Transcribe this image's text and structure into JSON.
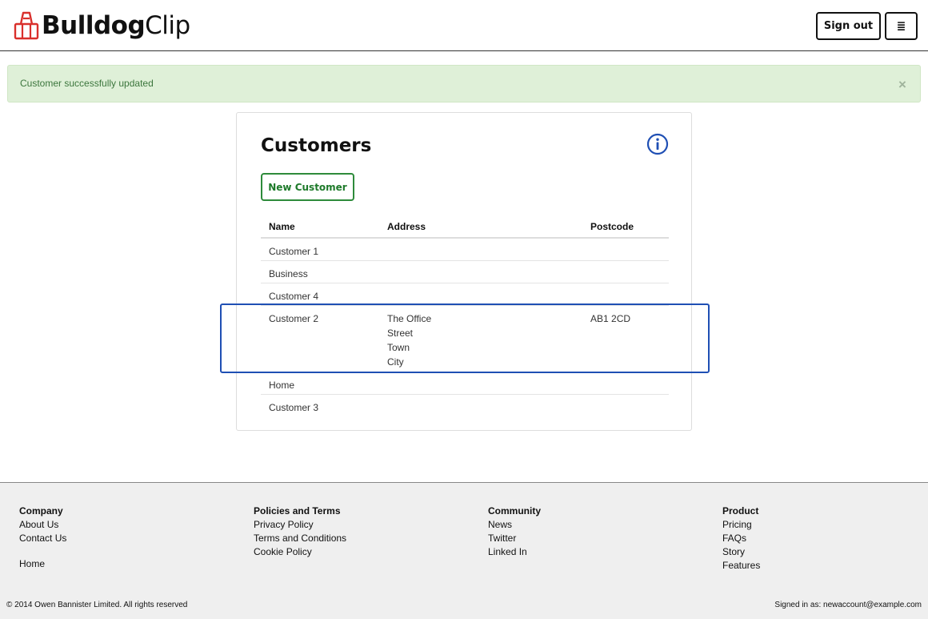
{
  "header": {
    "brand_bold": "Bulldog",
    "brand_light": "Clip",
    "signout_label": "Sign out",
    "menu_icon": "≣"
  },
  "alert": {
    "message": "Customer successfully updated",
    "close_label": "×"
  },
  "customers": {
    "title": "Customers",
    "new_label": "New Customer",
    "columns": [
      "Name",
      "Address",
      "Postcode"
    ],
    "rows": [
      {
        "name": "Customer 1",
        "address": [],
        "postcode": ""
      },
      {
        "name": "Business",
        "address": [],
        "postcode": ""
      },
      {
        "name": "Customer 4",
        "address": [],
        "postcode": ""
      },
      {
        "name": "Customer 2",
        "address": [
          "The Office",
          "Street",
          "Town",
          "City"
        ],
        "postcode": "AB1 2CD"
      },
      {
        "name": "Home",
        "address": [],
        "postcode": ""
      },
      {
        "name": "Customer 3",
        "address": [],
        "postcode": ""
      }
    ]
  },
  "footer": {
    "company": {
      "heading": "Company",
      "links": [
        "About Us",
        "Contact Us"
      ],
      "extra": "Home"
    },
    "policies": {
      "heading": "Policies and Terms",
      "links": [
        "Privacy Policy",
        "Terms and Conditions",
        "Cookie Policy"
      ]
    },
    "community": {
      "heading": "Community",
      "links": [
        "News",
        "Twitter",
        "Linked In"
      ]
    },
    "product": {
      "heading": "Product",
      "links": [
        "Pricing",
        "FAQs",
        "Story",
        "Features"
      ]
    },
    "copyright": "© 2014 Owen Bannister Limited. All rights reserved",
    "signed_in": "Signed in as: newaccount@example.com"
  },
  "colors": {
    "alert_bg": "#dff0d8",
    "alert_text": "#3c763d",
    "brand_red": "#d9302c",
    "primary_green": "#2e8b3b",
    "info_blue": "#1f4fb4"
  }
}
